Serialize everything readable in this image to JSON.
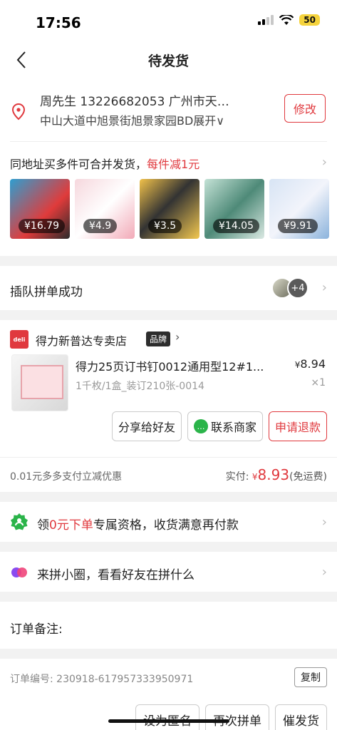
{
  "status": {
    "time": "17:56",
    "battery": "50"
  },
  "nav": {
    "title": "待发货"
  },
  "address": {
    "line1": "周先生  13226682053  广州市天…",
    "line2": "中山大道中旭景街旭景家园BD展开∨",
    "edit_label": "修改"
  },
  "merge": {
    "title_prefix": "同地址买多件可合并发货，",
    "title_highlight": "每件减1元",
    "items": [
      {
        "price": "¥16.79"
      },
      {
        "price": "¥4.9"
      },
      {
        "price": "¥3.5"
      },
      {
        "price": "¥14.05"
      },
      {
        "price": "¥9.91"
      }
    ]
  },
  "group": {
    "title": "插队拼单成功",
    "extra_count": "+4"
  },
  "shop": {
    "logo_text": "deli",
    "name": "得力新普达专卖店",
    "badge": "品牌",
    "product_title": "得力25页订书钉0012通用型12#1...",
    "product_price": "8.94",
    "product_spec": "1千枚/1盒_装订210张-0014",
    "product_qty": "×1",
    "btn_share": "分享给好友",
    "btn_contact": "联系商家",
    "btn_refund": "申请退款"
  },
  "payment": {
    "discount_text": "0.01元多多支付立减优惠",
    "paid_label": "实付:",
    "paid_amount": "8.93",
    "shipping_note": "(免运费)"
  },
  "promo": {
    "prefix": "领",
    "highlight": "0元下单",
    "suffix": "专属资格，收货满意再付款"
  },
  "circle": {
    "text": "来拼小圈，看看好友在拼什么"
  },
  "note": {
    "label": "订单备注:"
  },
  "order": {
    "number_text": "订单编号:  230918-617957333950971",
    "copy_label": "复制"
  },
  "bottom": {
    "anon_label": "设为匿名",
    "again_label": "再次拼单",
    "urge_label": "催发货"
  },
  "colors": {
    "accent": "#e0393e"
  }
}
